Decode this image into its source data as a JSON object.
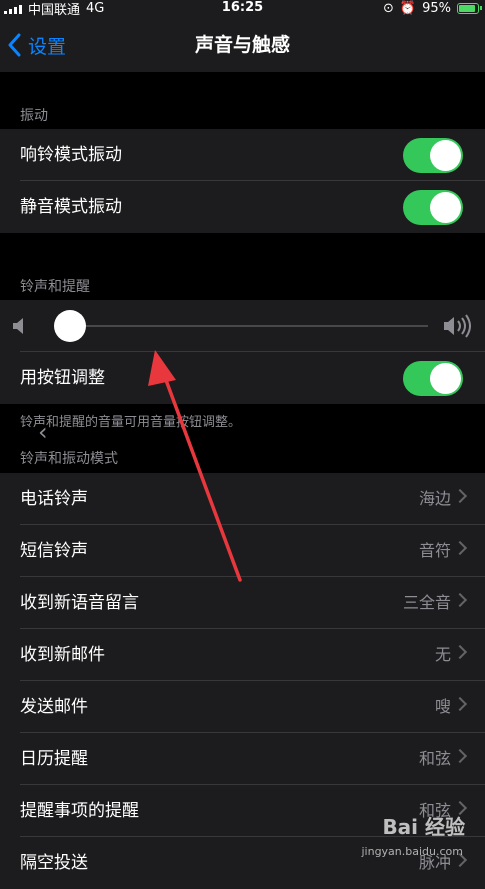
{
  "status_bar": {
    "carrier": "中国联通",
    "network": "4G",
    "time": "16:25",
    "battery": "95%"
  },
  "nav": {
    "back_label": "设置",
    "title": "声音与触感"
  },
  "vibration": {
    "header": "振动",
    "rows": [
      {
        "label": "响铃模式振动",
        "on": true
      },
      {
        "label": "静音模式振动",
        "on": true
      }
    ]
  },
  "ringer": {
    "header": "铃声和提醒",
    "volume_fraction": 0.0,
    "change_with_buttons_label": "用按钮调整",
    "change_with_buttons_on": true,
    "footer": "铃声和提醒的音量可用音量按钮调整。"
  },
  "patterns": {
    "header": "铃声和振动模式",
    "rows": [
      {
        "label": "电话铃声",
        "value": "海边"
      },
      {
        "label": "短信铃声",
        "value": "音符"
      },
      {
        "label": "收到新语音留言",
        "value": "三全音"
      },
      {
        "label": "收到新邮件",
        "value": "无"
      },
      {
        "label": "发送邮件",
        "value": "嗖"
      },
      {
        "label": "日历提醒",
        "value": "和弦"
      },
      {
        "label": "提醒事项的提醒",
        "value": "和弦"
      },
      {
        "label": "隔空投送",
        "value": "脉冲"
      }
    ]
  },
  "watermark": {
    "brand": "Bai 经验",
    "url": "jingyan.baidu.com"
  },
  "colors": {
    "accent": "#0a84ff",
    "toggle_on": "#34c759",
    "annotation_arrow": "#e8383d"
  }
}
